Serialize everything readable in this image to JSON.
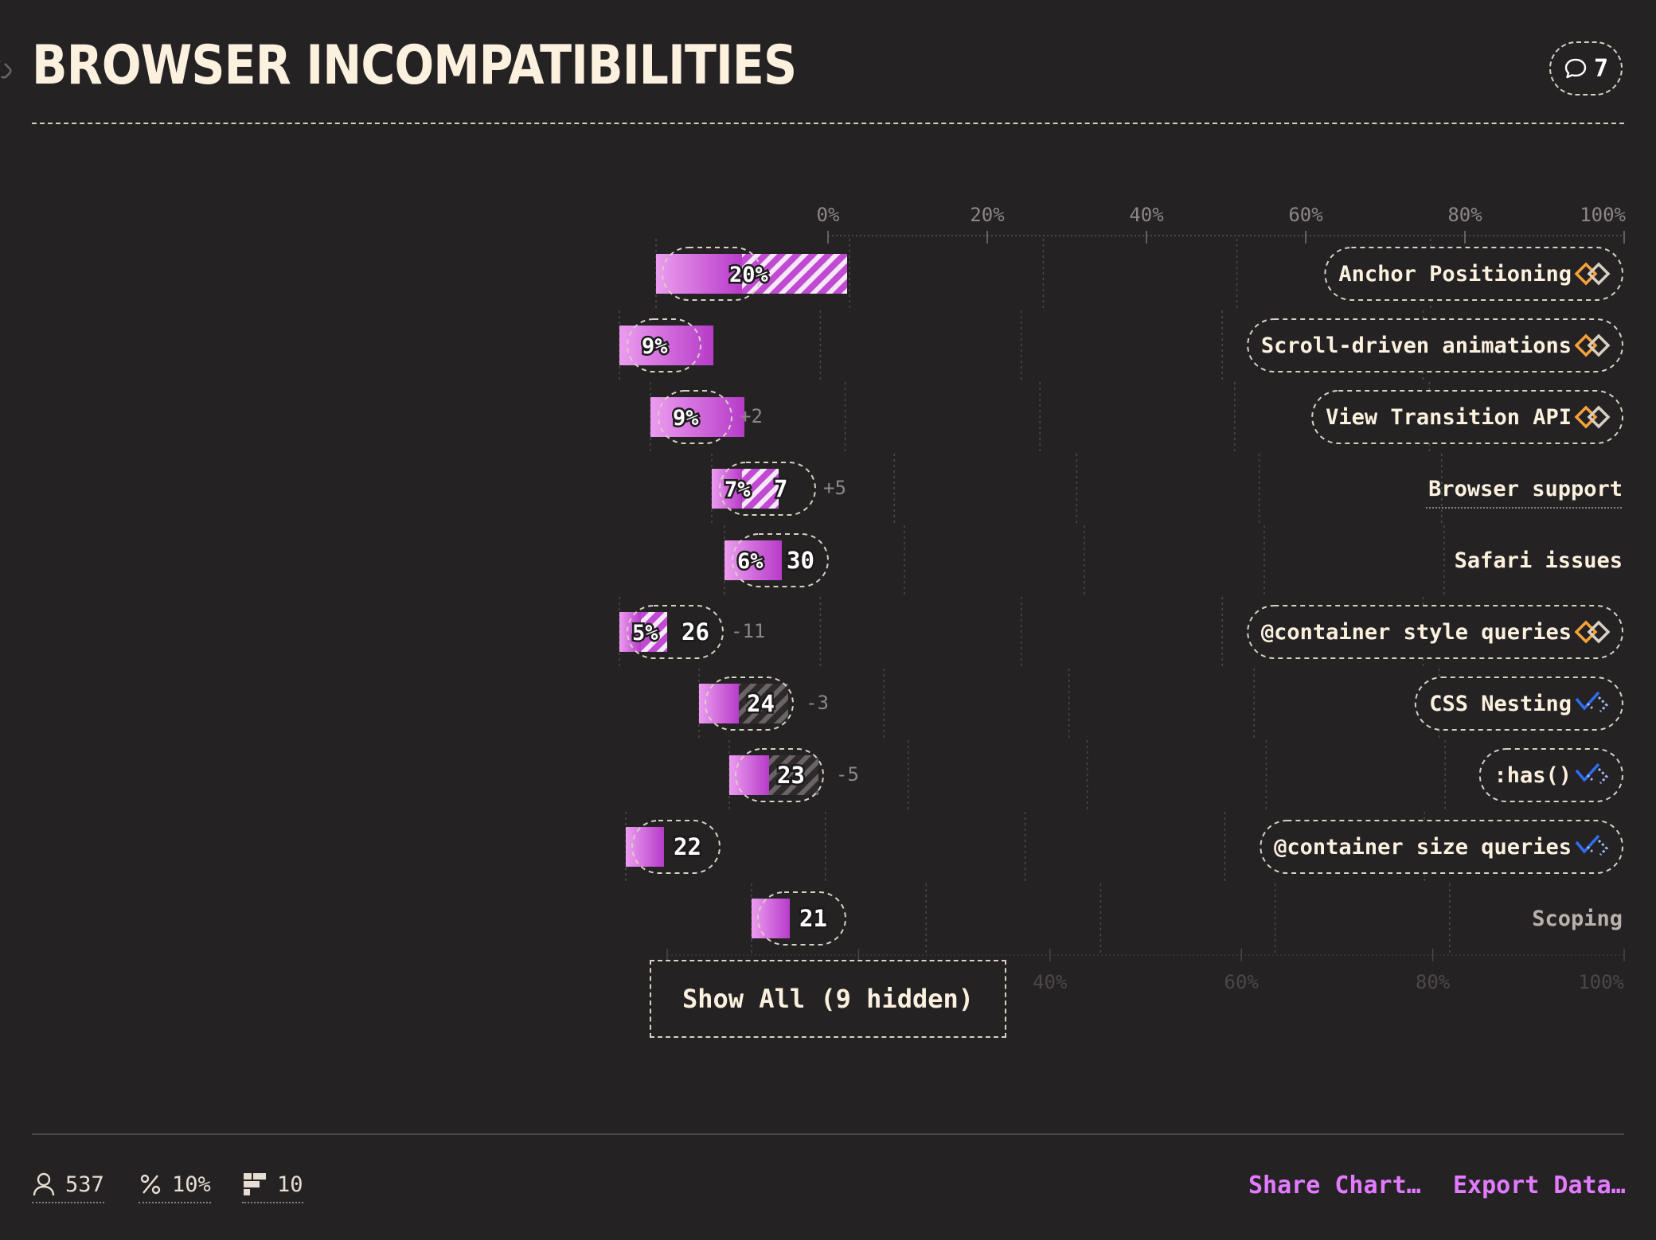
{
  "header": {
    "title": "BROWSER INCOMPATIBILITIES",
    "comment_count": "7"
  },
  "show_all_label": "Show All (9 hidden)",
  "footer": {
    "respondents": "537",
    "percent_mode": "10%",
    "items_count": "10",
    "share_label": "Share Chart…",
    "export_label": "Export Data…"
  },
  "colors": {
    "background": "#252224",
    "bar_start": "#ec9df0",
    "bar_end": "#b73bc9",
    "feature_icon_orange": "#f5a23a",
    "feature_icon_blue": "#2f6ef5",
    "accent_link": "#e27bff"
  },
  "chart_data": {
    "type": "bar",
    "orientation": "horizontal",
    "axis_ticks": [
      "0%",
      "20%",
      "40%",
      "60%",
      "80%",
      "100%"
    ],
    "xlim": [
      0,
      100
    ],
    "grid": true,
    "rows": [
      {
        "label": "Anchor Positioning",
        "percent": 20,
        "value_label": "20%",
        "count": null,
        "change": null,
        "pattern": "pink-stripes",
        "feature_icon": "orange",
        "pill": true
      },
      {
        "label": "Scroll-driven animations",
        "percent": 9,
        "value_label": "9%",
        "count": null,
        "change": null,
        "pattern": "solid",
        "feature_icon": "orange",
        "pill": true
      },
      {
        "label": "View Transition API",
        "percent": 9,
        "value_label": "9%",
        "count": null,
        "change": "+2",
        "pattern": "solid",
        "feature_icon": "orange",
        "pill": true
      },
      {
        "label": "Browser support",
        "percent": 7,
        "value_label": "7%",
        "count": "7",
        "change": "+5",
        "pattern": "pink-stripes",
        "feature_icon": null,
        "pill": false
      },
      {
        "label": "Safari issues",
        "percent": 6,
        "value_label": "6%",
        "count": "30",
        "change": null,
        "pattern": "solid",
        "feature_icon": null,
        "pill": false
      },
      {
        "label": "@container style queries",
        "percent": 5,
        "value_label": "5%",
        "count": "26",
        "change": "-11",
        "pattern": "pink-stripes",
        "feature_icon": "orange",
        "pill": true
      },
      {
        "label": "CSS Nesting",
        "percent": 5,
        "value_label": null,
        "count": "24",
        "change": "-3",
        "pattern": "dark-stripes",
        "feature_icon": "blue",
        "pill": true
      },
      {
        "label": ":has()",
        "percent": 4,
        "value_label": null,
        "count": "23",
        "change": "-5",
        "pattern": "dark-stripes",
        "feature_icon": "blue",
        "pill": true
      },
      {
        "label": "@container size queries",
        "percent": 4,
        "value_label": null,
        "count": "22",
        "change": null,
        "pattern": "solid",
        "feature_icon": "blue",
        "pill": true
      },
      {
        "label": "Scoping",
        "percent": 4,
        "value_label": null,
        "count": "21",
        "change": null,
        "pattern": "solid",
        "feature_icon": null,
        "pill": false
      }
    ]
  }
}
